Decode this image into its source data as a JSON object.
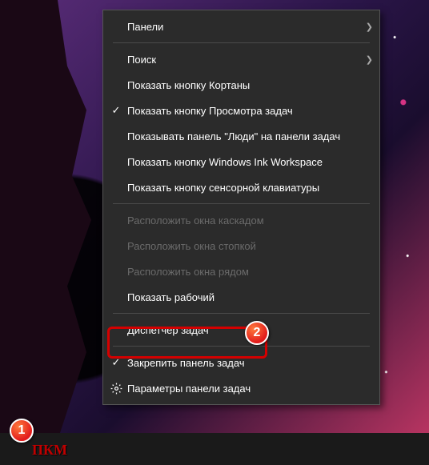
{
  "menu": {
    "panels": "Панели",
    "search": "Поиск",
    "cortana": "Показать кнопку Кортаны",
    "taskview": "Показать кнопку Просмотра задач",
    "people": "Показывать панель \"Люди\" на панели задач",
    "ink": "Показать кнопку Windows Ink Workspace",
    "touchkb": "Показать кнопку сенсорной клавиатуры",
    "cascade": "Расположить окна каскадом",
    "stacked": "Расположить окна стопкой",
    "sidebyside": "Расположить окна рядом",
    "showdesktop": "Показать рабочий",
    "taskmgr": "Диспетчер задач",
    "lock": "Закрепить панель задач",
    "settings": "Параметры панели задач"
  },
  "badges": {
    "one": "1",
    "two": "2"
  },
  "annotation": {
    "pkm": "ПКМ"
  }
}
